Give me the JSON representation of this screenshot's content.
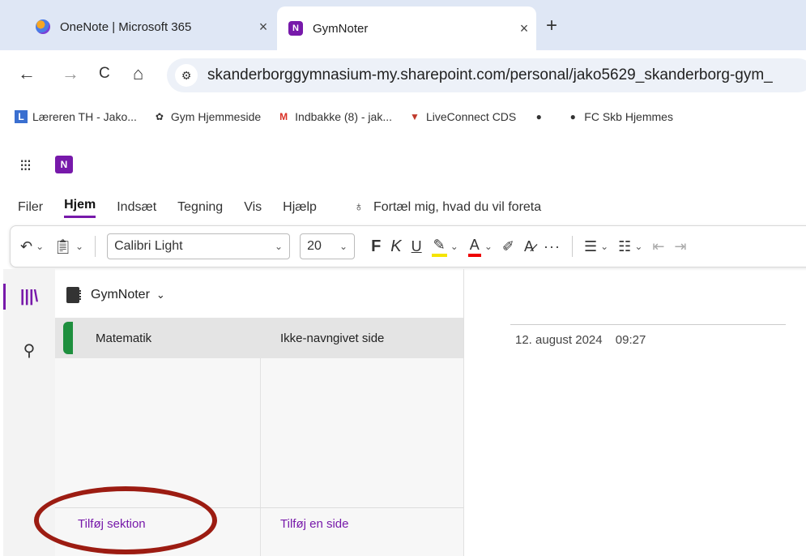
{
  "browser": {
    "tabs": [
      {
        "title": "OneNote | Microsoft 365",
        "active": false
      },
      {
        "title": "GymNoter",
        "active": true
      }
    ],
    "new_tab": "+",
    "close": "×",
    "nav": {
      "back": "←",
      "forward": "→",
      "reload": "C",
      "home": "⌂"
    },
    "url": "skanderborggymnasium-my.sharepoint.com/personal/jako5629_skanderborg-gym_",
    "bookmarks": [
      "Læreren TH - Jako...",
      "Gym Hjemmeside",
      "Indbakke (8) - jak...",
      "LiveConnect CDS",
      "",
      "FC Skb Hjemmes"
    ]
  },
  "app": {
    "menu": [
      "Filer",
      "Hjem",
      "Indsæt",
      "Tegning",
      "Vis",
      "Hjælp"
    ],
    "menu_active": "Hjem",
    "tell_me": "Fortæl mig, hvad du vil foreta",
    "toolbar": {
      "font": "Calibri Light",
      "size": "20",
      "bold": "F",
      "italic": "K",
      "underline": "U",
      "fontcolor": "A"
    }
  },
  "notebook": {
    "name": "GymNoter",
    "sections": [
      {
        "name": "Matematik",
        "color": "#1e8f3e"
      }
    ],
    "pages": [
      {
        "title": "Ikke-navngivet side"
      }
    ],
    "add_section": "Tilføj sektion",
    "add_page": "Tilføj en side"
  },
  "page": {
    "date": "12. august 2024",
    "time": "09:27"
  },
  "colors": {
    "accent": "#7719aa",
    "annotation": "#9c1c12"
  }
}
